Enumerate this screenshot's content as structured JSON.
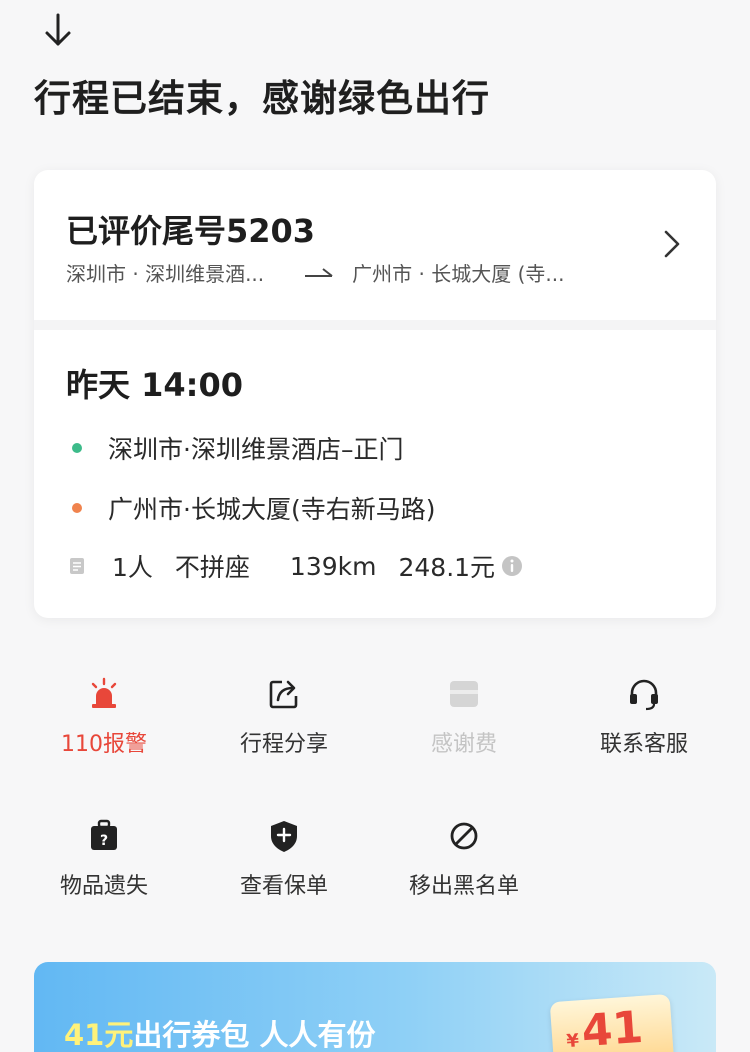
{
  "header": {
    "collapse_icon": "arrow-down-icon",
    "title": "行程已结束，感谢绿色出行"
  },
  "order": {
    "title": "已评价尾号5203",
    "from_short": "深圳市 · 深圳维景酒...",
    "to_short": "广州市 · 长城大厦 (寺...",
    "chevron_icon": "chevron-right-icon"
  },
  "trip": {
    "time": "昨天 14:00",
    "start": "深圳市·深圳维景酒店–正门",
    "end": "广州市·长城大厦(寺右新马路)",
    "passengers": "1人",
    "seat_type": "不拼座",
    "distance": "139km",
    "price": "248.1元",
    "colors": {
      "start_dot": "#3dbb8a",
      "end_dot": "#f0834d"
    }
  },
  "actions": [
    {
      "label": "110报警",
      "icon": "alarm-light-icon"
    },
    {
      "label": "行程分享",
      "icon": "share-icon"
    },
    {
      "label": "感谢费",
      "icon": "wallet-icon"
    },
    {
      "label": "联系客服",
      "icon": "headset-icon"
    },
    {
      "label": "物品遗失",
      "icon": "lost-bag-icon"
    },
    {
      "label": "查看保单",
      "icon": "shield-plus-icon"
    },
    {
      "label": "移出黑名单",
      "icon": "ban-icon"
    }
  ],
  "promo": {
    "amount": "41元",
    "text": "出行券包 人人有份",
    "badge_currency": "¥",
    "badge_number": "41"
  },
  "theme": {
    "alarm_color": "#e8473a",
    "promo_blue": "#62b8f3"
  }
}
